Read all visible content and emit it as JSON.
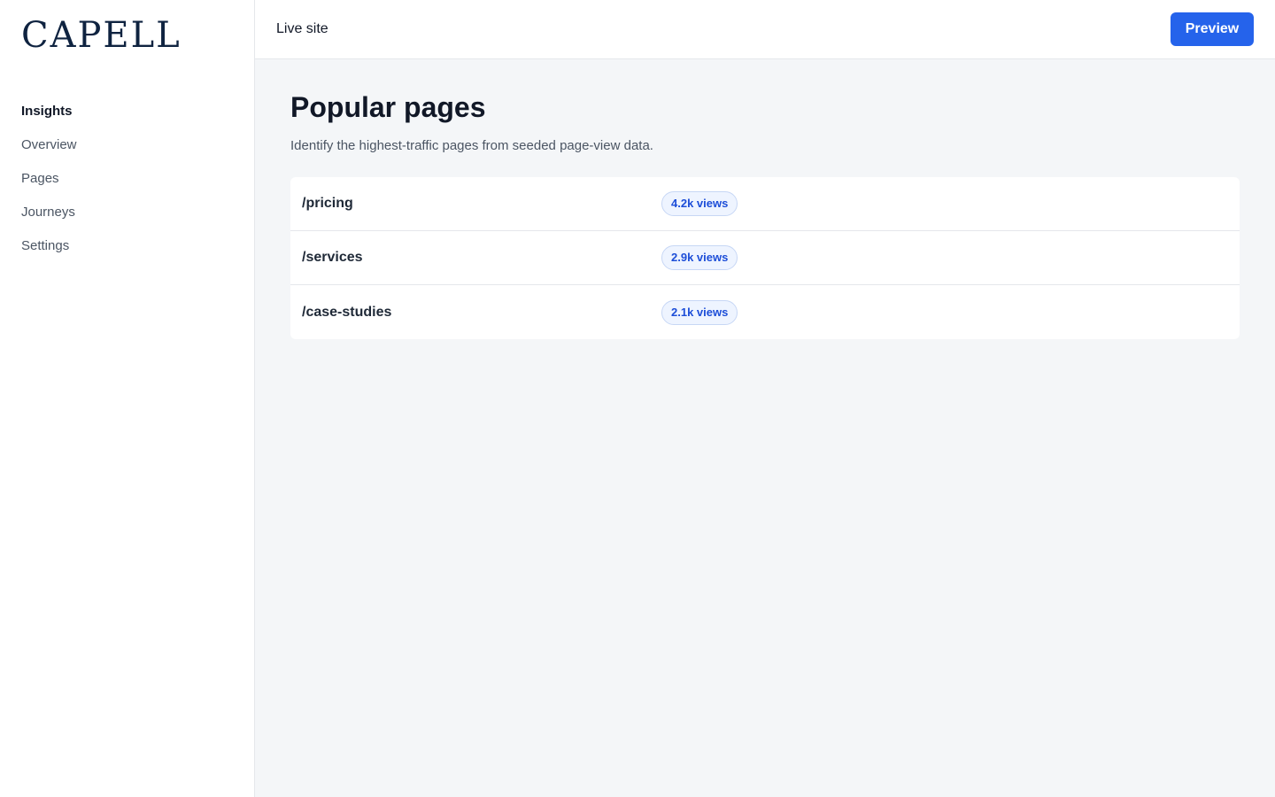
{
  "brand": {
    "logo_text": "CAPELL"
  },
  "sidebar": {
    "heading": "Insights",
    "items": [
      {
        "label": "Overview"
      },
      {
        "label": "Pages"
      },
      {
        "label": "Journeys"
      },
      {
        "label": "Settings"
      }
    ]
  },
  "topbar": {
    "site_label": "Live site",
    "preview_label": "Preview"
  },
  "main": {
    "title": "Popular pages",
    "subtitle": "Identify the highest-traffic pages from seeded page-view data.",
    "rows": [
      {
        "path": "/pricing",
        "views": "4.2k views"
      },
      {
        "path": "/services",
        "views": "2.9k views"
      },
      {
        "path": "/case-studies",
        "views": "2.1k views"
      }
    ]
  },
  "colors": {
    "accent": "#2563eb",
    "brand": "#0f2340",
    "badge_text": "#1d4ed8",
    "badge_bg": "#eef4ff"
  }
}
